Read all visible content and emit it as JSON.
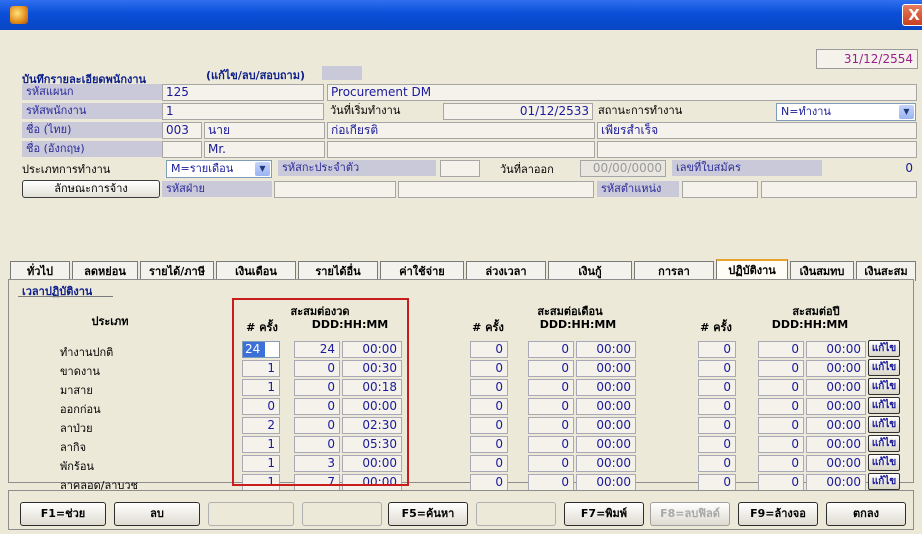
{
  "window": {
    "close_glyph": "X"
  },
  "top_date": "31/12/2554",
  "section_title": "บันทึกรายละเอียดพนักงาน",
  "mode_label": "(แก้ไข/ลบ/สอบถาม)",
  "form": {
    "dept_code_label": "รหัสแผนก",
    "dept_code": "125",
    "dept_name": "Procurement DM",
    "emp_code_label": "รหัสพนักงาน",
    "emp_code": "1",
    "start_date_label": "วันที่เริ่มทำงาน",
    "start_date": "01/12/2533",
    "work_status_label": "สถานะการทำงาน",
    "work_status": "N=ทำงาน",
    "name_th_label": "ชื่อ (ไทย)",
    "title_code": "003",
    "title_th": "นาย",
    "first_name_th": "ก่อเกียรติ",
    "last_name_th": "เพียรสำเร็จ",
    "name_en_label": "ชื่อ (อังกฤษ)",
    "title_en": "Mr.",
    "emp_type_label": "ประเภทการทำงาน",
    "emp_type": "M=รายเดือน",
    "id_code_label": "รหัสกะประจำตัว",
    "resign_date_label": "วันที่ลาออก",
    "resign_date": "00/00/0000",
    "application_no_label": "เลขที่ใบสมัคร",
    "application_no": "0",
    "employment_button": "ลักษณะการจ้าง",
    "division_code_label": "รหัสฝ่าย",
    "position_code_label": "รหัสตำแหน่ง"
  },
  "tabs": [
    "ทั่วไป",
    "ลดหย่อน",
    "รายได้/ภาษี",
    "เงินเดือน",
    "รายได้อื่น",
    "ค่าใช้จ่าย",
    "ล่วงเวลา",
    "เงินกู้",
    "การลา",
    "ปฏิบัติงาน",
    "เงินสมทบ",
    "เงินสะสม"
  ],
  "panel": {
    "title": "เวลาปฏิบัติงาน",
    "type_header": "ประเภท",
    "group_period": "สะสมต่องวด",
    "group_month": "สะสมต่อเดือน",
    "group_year": "สะสมต่อปี",
    "count_header": "# ครั้ง",
    "time_header": "DDD:HH:MM",
    "edit_label": "แก้ไข",
    "rows": [
      {
        "label": "ทำงานปกติ",
        "p_count": "24",
        "p_days": "24",
        "p_time": "00:00",
        "m_count": "0",
        "m_days": "0",
        "m_time": "00:00",
        "y_count": "0",
        "y_days": "0",
        "y_time": "00:00"
      },
      {
        "label": "ขาดงาน",
        "p_count": "1",
        "p_days": "0",
        "p_time": "00:30",
        "m_count": "0",
        "m_days": "0",
        "m_time": "00:00",
        "y_count": "0",
        "y_days": "0",
        "y_time": "00:00"
      },
      {
        "label": "มาสาย",
        "p_count": "1",
        "p_days": "0",
        "p_time": "00:18",
        "m_count": "0",
        "m_days": "0",
        "m_time": "00:00",
        "y_count": "0",
        "y_days": "0",
        "y_time": "00:00"
      },
      {
        "label": "ออกก่อน",
        "p_count": "0",
        "p_days": "0",
        "p_time": "00:00",
        "m_count": "0",
        "m_days": "0",
        "m_time": "00:00",
        "y_count": "0",
        "y_days": "0",
        "y_time": "00:00"
      },
      {
        "label": "ลาป่วย",
        "p_count": "2",
        "p_days": "0",
        "p_time": "02:30",
        "m_count": "0",
        "m_days": "0",
        "m_time": "00:00",
        "y_count": "0",
        "y_days": "0",
        "y_time": "00:00"
      },
      {
        "label": "ลากิจ",
        "p_count": "1",
        "p_days": "0",
        "p_time": "05:30",
        "m_count": "0",
        "m_days": "0",
        "m_time": "00:00",
        "y_count": "0",
        "y_days": "0",
        "y_time": "00:00"
      },
      {
        "label": "พักร้อน",
        "p_count": "1",
        "p_days": "3",
        "p_time": "00:00",
        "m_count": "0",
        "m_days": "0",
        "m_time": "00:00",
        "y_count": "0",
        "y_days": "0",
        "y_time": "00:00"
      },
      {
        "label": "ลาคลอด/ลาบวช",
        "p_count": "1",
        "p_days": "7",
        "p_time": "00:00",
        "m_count": "0",
        "m_days": "0",
        "m_time": "00:00",
        "y_count": "0",
        "y_days": "0",
        "y_time": "00:00"
      }
    ]
  },
  "function_keys": {
    "help": "F1=ช่วย",
    "delete": "ลบ",
    "search": "F5=ค้นหา",
    "print": "F7=พิมพ์",
    "clear_field": "F8=ลบฟิลด์",
    "clear_screen": "F9=ล้างจอ",
    "ok": "ตกลง"
  },
  "colors": {
    "title_bar": "#0a4fd8",
    "label_bg": "#c9c9d9",
    "highlight_frame": "#c81d1d",
    "date_text": "#9b1e8c"
  }
}
